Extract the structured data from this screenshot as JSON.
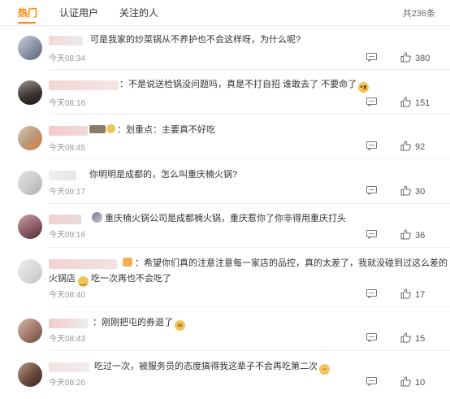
{
  "tabs": [
    {
      "label": "热门",
      "active": true
    },
    {
      "label": "认证用户",
      "active": false
    },
    {
      "label": "关注的人",
      "active": false
    }
  ],
  "total_label": "共236条",
  "colors": {
    "accent": "#ff8200",
    "text": "#333333",
    "muted": "#999999"
  },
  "comments": [
    {
      "text": "可是我家的炒菜锅从不养护也不会这样呀，为什么呢?",
      "time": "今天08:34",
      "likes": "380",
      "avatar_color": "#8a93a6"
    },
    {
      "text": "：不是说送检锅没问题吗，真是不打自招 谁敢去了 不要命了",
      "emoji": "dog-face-emoji",
      "time": "今天08:16",
      "likes": "151",
      "avatar_color": "#3a3230"
    },
    {
      "text": "：划重点：主要真不好吃",
      "time": "今天08:45",
      "likes": "92",
      "avatar_color": "#b89a7c"
    },
    {
      "text": "你明明是成都的，怎么叫重庆楠火锅?",
      "time": "今天09:17",
      "likes": "30",
      "avatar_color": "#c9c9c9"
    },
    {
      "text": "重庆楠火锅公司是成都楠火锅，重庆惹你了你非得用重庆打头",
      "emoji_before": "sticker-emoji",
      "time": "今天09:16",
      "likes": "36",
      "avatar_color": "#8e5a68"
    },
    {
      "text": "：希望你们真的注意注意每一家店的品控，真的太差了，我就没碰到过这么差的",
      "text2": "火锅店",
      "text3": "吃一次再也不会吃了",
      "emoji": "grin-emoji",
      "time": "今天08:40",
      "likes": "17",
      "avatar_color": "#d7d7d7"
    },
    {
      "text": "：刚刚把屯的券退了",
      "emoji": "glasses-emoji",
      "time": "今天08:43",
      "likes": "15",
      "avatar_color": "#a0786a"
    },
    {
      "text": "吃过一次，被服务员的态度搞得我这辈子不会再吃第二次",
      "emoji": "laugh-emoji",
      "time": "今天08:26",
      "likes": "10",
      "avatar_color": "#6b4a3c"
    }
  ]
}
